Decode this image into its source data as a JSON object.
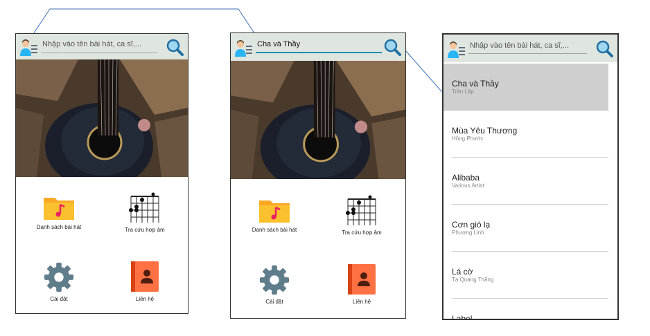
{
  "search": {
    "placeholder": "Nhập vào tên bài hát, ca sĩ,...",
    "typed_query": "Cha và Thầy"
  },
  "menu": {
    "song_list": "Danh sách bài hát",
    "chord_lookup": "Tra cứu hợp âm",
    "settings": "Cài đặt",
    "contact": "Liên hệ"
  },
  "results": [
    {
      "title": "Cha và Thầy",
      "artist": "Trần Lập"
    },
    {
      "title": "Mùa Yêu Thương",
      "artist": "Hồng Phước"
    },
    {
      "title": "Alibaba",
      "artist": "Various Artist"
    },
    {
      "title": "Cơn gió lạ",
      "artist": "Phương Linh"
    },
    {
      "title": "Lá cờ",
      "artist": "Tạ Quang Thắng"
    },
    {
      "title": "Label",
      "artist": ""
    }
  ],
  "colors": {
    "topbar": "#dfe6df",
    "folder": "#fbc02d",
    "music_note": "#e91e63",
    "gear": "#607d8b",
    "contact_book": "#ff7043",
    "selected_row": "#cfcfcf",
    "flow_arrow": "#3d6fb6"
  },
  "icons": [
    "avatar-icon",
    "search-icon",
    "folder-music-icon",
    "guitar-chord-icon",
    "gear-icon",
    "contact-book-icon"
  ]
}
